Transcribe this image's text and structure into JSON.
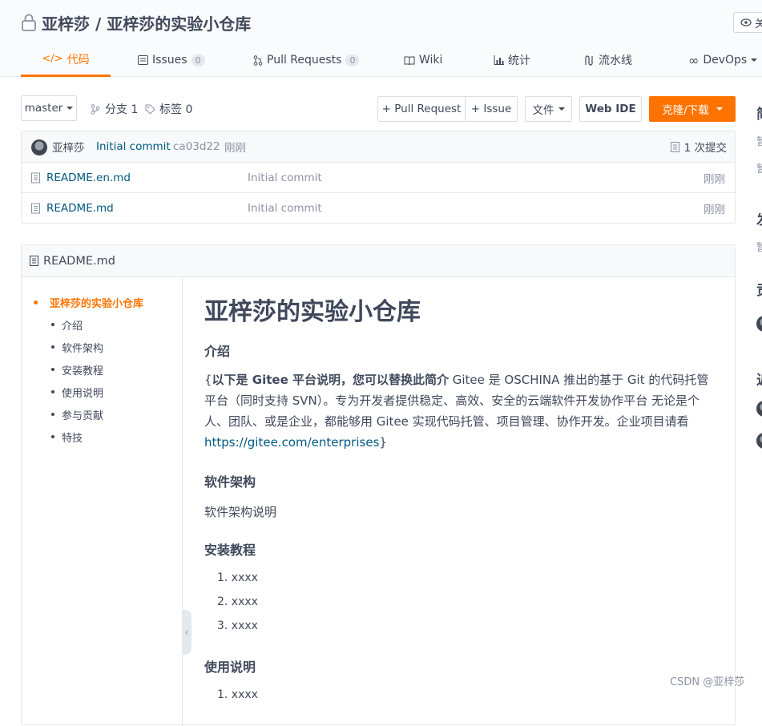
{
  "repo": {
    "title": "亚梓莎 / 亚梓莎的实验小仓库",
    "watch_label": "关"
  },
  "nav": {
    "code": "代码",
    "issues": "Issues",
    "issues_count": "0",
    "pull_requests": "Pull Requests",
    "pr_count": "0",
    "wiki": "Wiki",
    "stats": "统计",
    "pipeline": "流水线",
    "devops": "DevOps"
  },
  "toolbar": {
    "branch": "master",
    "branches": "分支 1",
    "tags": "标签 0",
    "new_pr": "+ Pull Request",
    "new_issue": "+ Issue",
    "files": "文件",
    "web_ide": "Web IDE",
    "clone": "克隆/下载"
  },
  "last_commit": {
    "author": "亚梓莎",
    "message": "Initial commit",
    "hash": "ca03d22",
    "time": "刚刚",
    "commit_count": "1 次提交"
  },
  "files": [
    {
      "name": "README.en.md",
      "message": "Initial commit",
      "time": "刚刚"
    },
    {
      "name": "README.md",
      "message": "Initial commit",
      "time": "刚刚"
    }
  ],
  "readme": {
    "filename": "README.md",
    "toc": [
      "亚梓莎的实验小仓库",
      "介绍",
      "软件架构",
      "安装教程",
      "使用说明",
      "参与贡献",
      "特技"
    ],
    "h1": "亚梓莎的实验小仓库",
    "h_intro": "介绍",
    "intro_bold": "以下是 Gitee 平台说明，您可以替换此简介",
    "intro_open": "{",
    "intro_text": " Gitee 是 OSCHINA 推出的基于 Git 的代码托管平台（同时支持 SVN）。专为开发者提供稳定、高效、安全的云端软件开发协作平台 无论是个人、团队、或是企业，都能够用 Gitee 实现代码托管、项目管理、协作开发。企业项目请看 ",
    "intro_link": "https://gitee.com/enterprises",
    "intro_close": "}",
    "h_arch": "软件架构",
    "arch_text": "软件架构说明",
    "h_install": "安装教程",
    "install_steps": [
      "1. xxxx",
      "2. xxxx",
      "3. xxxx"
    ],
    "h_usage": "使用说明",
    "usage_first": "1. xxxx"
  },
  "sidebar_fragments": [
    "简",
    "暂",
    "暂",
    "发",
    "暂",
    "贡",
    "近"
  ],
  "watermark": "CSDN @亚梓莎",
  "colors": {
    "accent": "#fe7300",
    "link": "#005980",
    "text": "#40485b",
    "muted": "#8c92a4"
  }
}
